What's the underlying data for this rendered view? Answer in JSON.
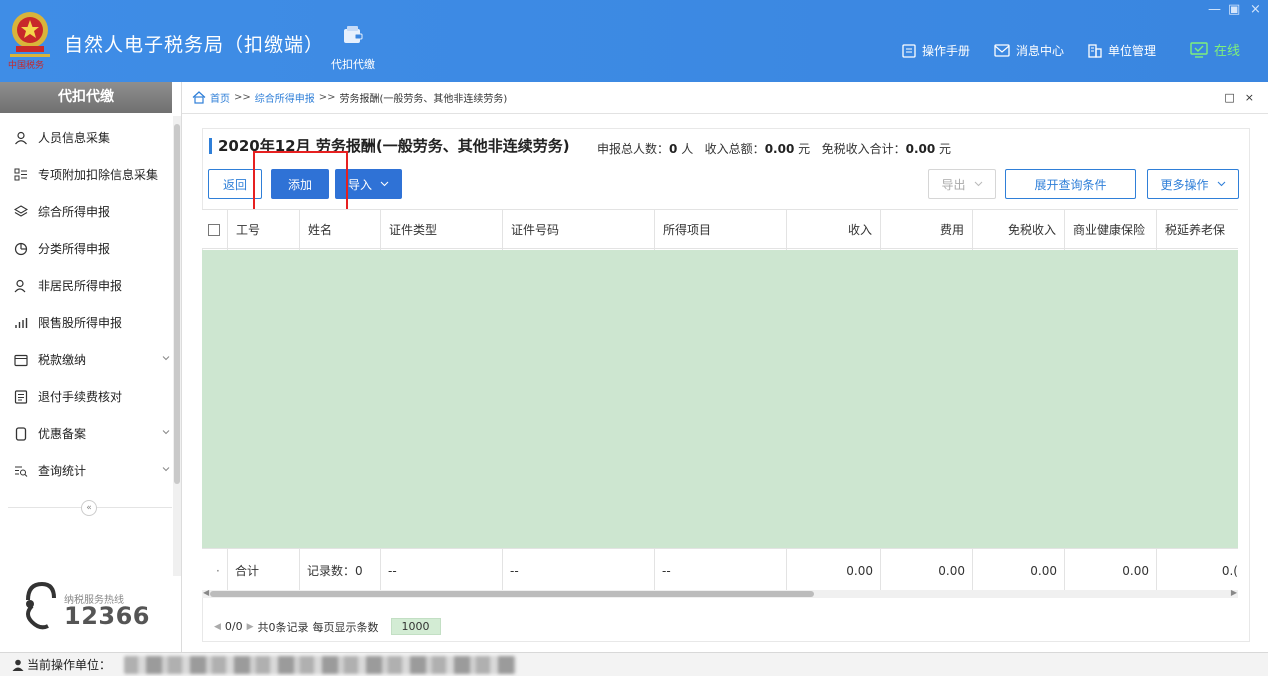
{
  "header": {
    "app_title": "自然人电子税务局（扣缴端）",
    "nav_tab_label": "代扣代缴",
    "links": {
      "manual": "操作手册",
      "messages": "消息中心",
      "unit_mgmt": "单位管理",
      "online": "在线"
    },
    "window_controls": [
      "—",
      "▣",
      "×"
    ]
  },
  "sidebar": {
    "title": "代扣代缴",
    "items": [
      {
        "label": "人员信息采集",
        "icon": "person-icon"
      },
      {
        "label": "专项附加扣除信息采集",
        "icon": "list-icon"
      },
      {
        "label": "综合所得申报",
        "icon": "layers-icon"
      },
      {
        "label": "分类所得申报",
        "icon": "pie-icon"
      },
      {
        "label": "非居民所得申报",
        "icon": "person-outline-icon"
      },
      {
        "label": "限售股所得申报",
        "icon": "bar-chart-icon"
      },
      {
        "label": "税款缴纳",
        "icon": "folder-icon"
      },
      {
        "label": "退付手续费核对",
        "icon": "document-icon"
      },
      {
        "label": "优惠备案",
        "icon": "page-icon"
      },
      {
        "label": "查询统计",
        "icon": "search-list-icon"
      }
    ],
    "collapse_symbol": "«",
    "hotline_label": "纳税服务热线",
    "hotline_number": "12366"
  },
  "breadcrumb": {
    "home": "首页",
    "sep": ">>",
    "level2": "综合所得申报",
    "current": "劳务报酬(一般劳务、其他非连续劳务)",
    "ctrl_restore": "□",
    "ctrl_close": "×"
  },
  "panel": {
    "title": "2020年12月 劳务报酬(一般劳务、其他非连续劳务)",
    "stats_people_label": "申报总人数：",
    "stats_people_value": "0",
    "stats_people_unit": "人",
    "stats_income_label": "收入总额：",
    "stats_income_value": "0.00",
    "stats_income_unit": "元",
    "stats_exempt_label": "免税收入合计：",
    "stats_exempt_value": "0.00",
    "stats_exempt_unit": "元"
  },
  "toolbar": {
    "back": "返回",
    "add": "添加",
    "import": "导入",
    "export": "导出",
    "expand_query": "展开查询条件",
    "more_ops": "更多操作"
  },
  "table": {
    "columns": [
      "工号",
      "姓名",
      "证件类型",
      "证件号码",
      "所得项目",
      "收入",
      "费用",
      "免税收入",
      "商业健康保险",
      "税延养老保"
    ],
    "footer": {
      "mark": "·",
      "total_label": "合计",
      "record_count": "记录数：0",
      "id_type": "--",
      "id_no": "--",
      "income_item": "--",
      "income": "0.00",
      "fees": "0.00",
      "exempt": "0.00",
      "health_ins": "0.00",
      "pension": "0.("
    }
  },
  "pager": {
    "page": "0/0",
    "records": "共0条记录",
    "per_page_label": "每页显示条数",
    "per_page_value": "1000"
  },
  "statusbar": {
    "label": "当前操作单位："
  },
  "colors": {
    "header_blue": "#3a86e0",
    "primary_button": "#2f72d6",
    "table_body_green": "#cde6d0",
    "highlight_red": "#e62020",
    "online_green": "#7ff07a"
  }
}
